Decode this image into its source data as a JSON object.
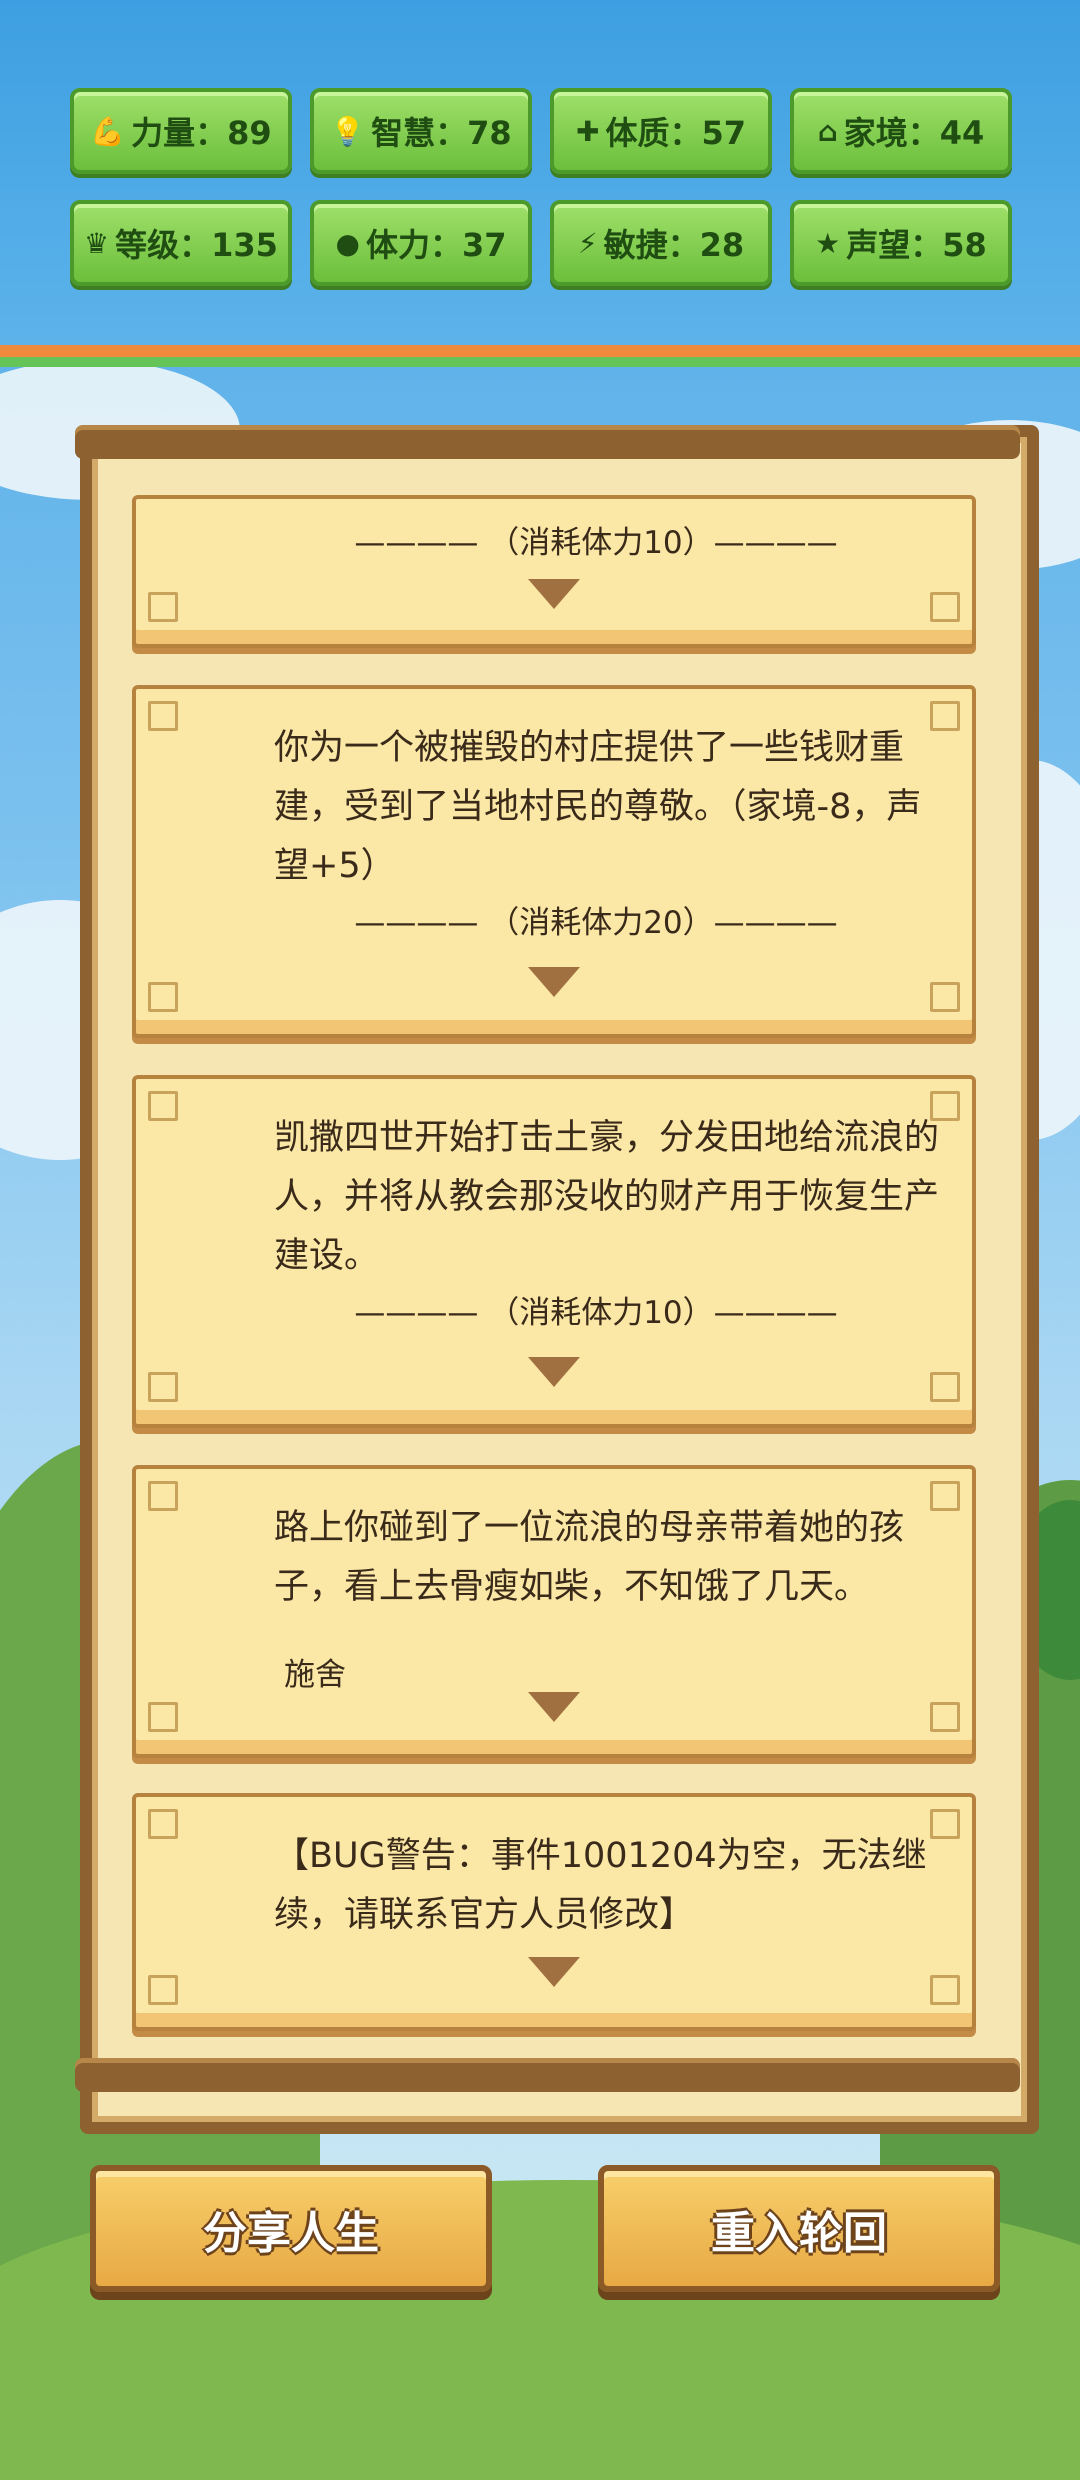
{
  "stats": [
    {
      "icon": "strength-icon",
      "glyph": "💪",
      "label": "力量：89"
    },
    {
      "icon": "wisdom-icon",
      "glyph": "💡",
      "label": "智慧：78"
    },
    {
      "icon": "constitution-icon",
      "glyph": "✚",
      "label": "体质：57"
    },
    {
      "icon": "family-icon",
      "glyph": "⌂",
      "label": "家境：44"
    },
    {
      "icon": "level-icon",
      "glyph": "♛",
      "label": "等级：135"
    },
    {
      "icon": "stamina-icon",
      "glyph": "●",
      "label": "体力：37"
    },
    {
      "icon": "agility-icon",
      "glyph": "⚡",
      "label": "敏捷：28"
    },
    {
      "icon": "reputation-icon",
      "glyph": "★",
      "label": "声望：58"
    }
  ],
  "events": [
    {
      "cost": "————  （消耗体力10）————"
    },
    {
      "text": "你为一个被摧毁的村庄提供了一些钱财重建，受到了当地村民的尊敬。（家境-8，声望+5）",
      "cost": "————  （消耗体力20）————"
    },
    {
      "text": "凯撒四世开始打击土豪，分发田地给流浪的人，并将从教会那没收的财产用于恢复生产建设。",
      "cost": "————  （消耗体力10）————"
    },
    {
      "text": "路上你碰到了一位流浪的母亲带着她的孩子，看上去骨瘦如柴，不知饿了几天。",
      "choice": "施舍"
    },
    {
      "text": "【BUG警告：事件1001204为空，无法继续，请联系官方人员修改】"
    }
  ],
  "buttons": {
    "share": "分享人生",
    "restart": "重入轮回"
  }
}
